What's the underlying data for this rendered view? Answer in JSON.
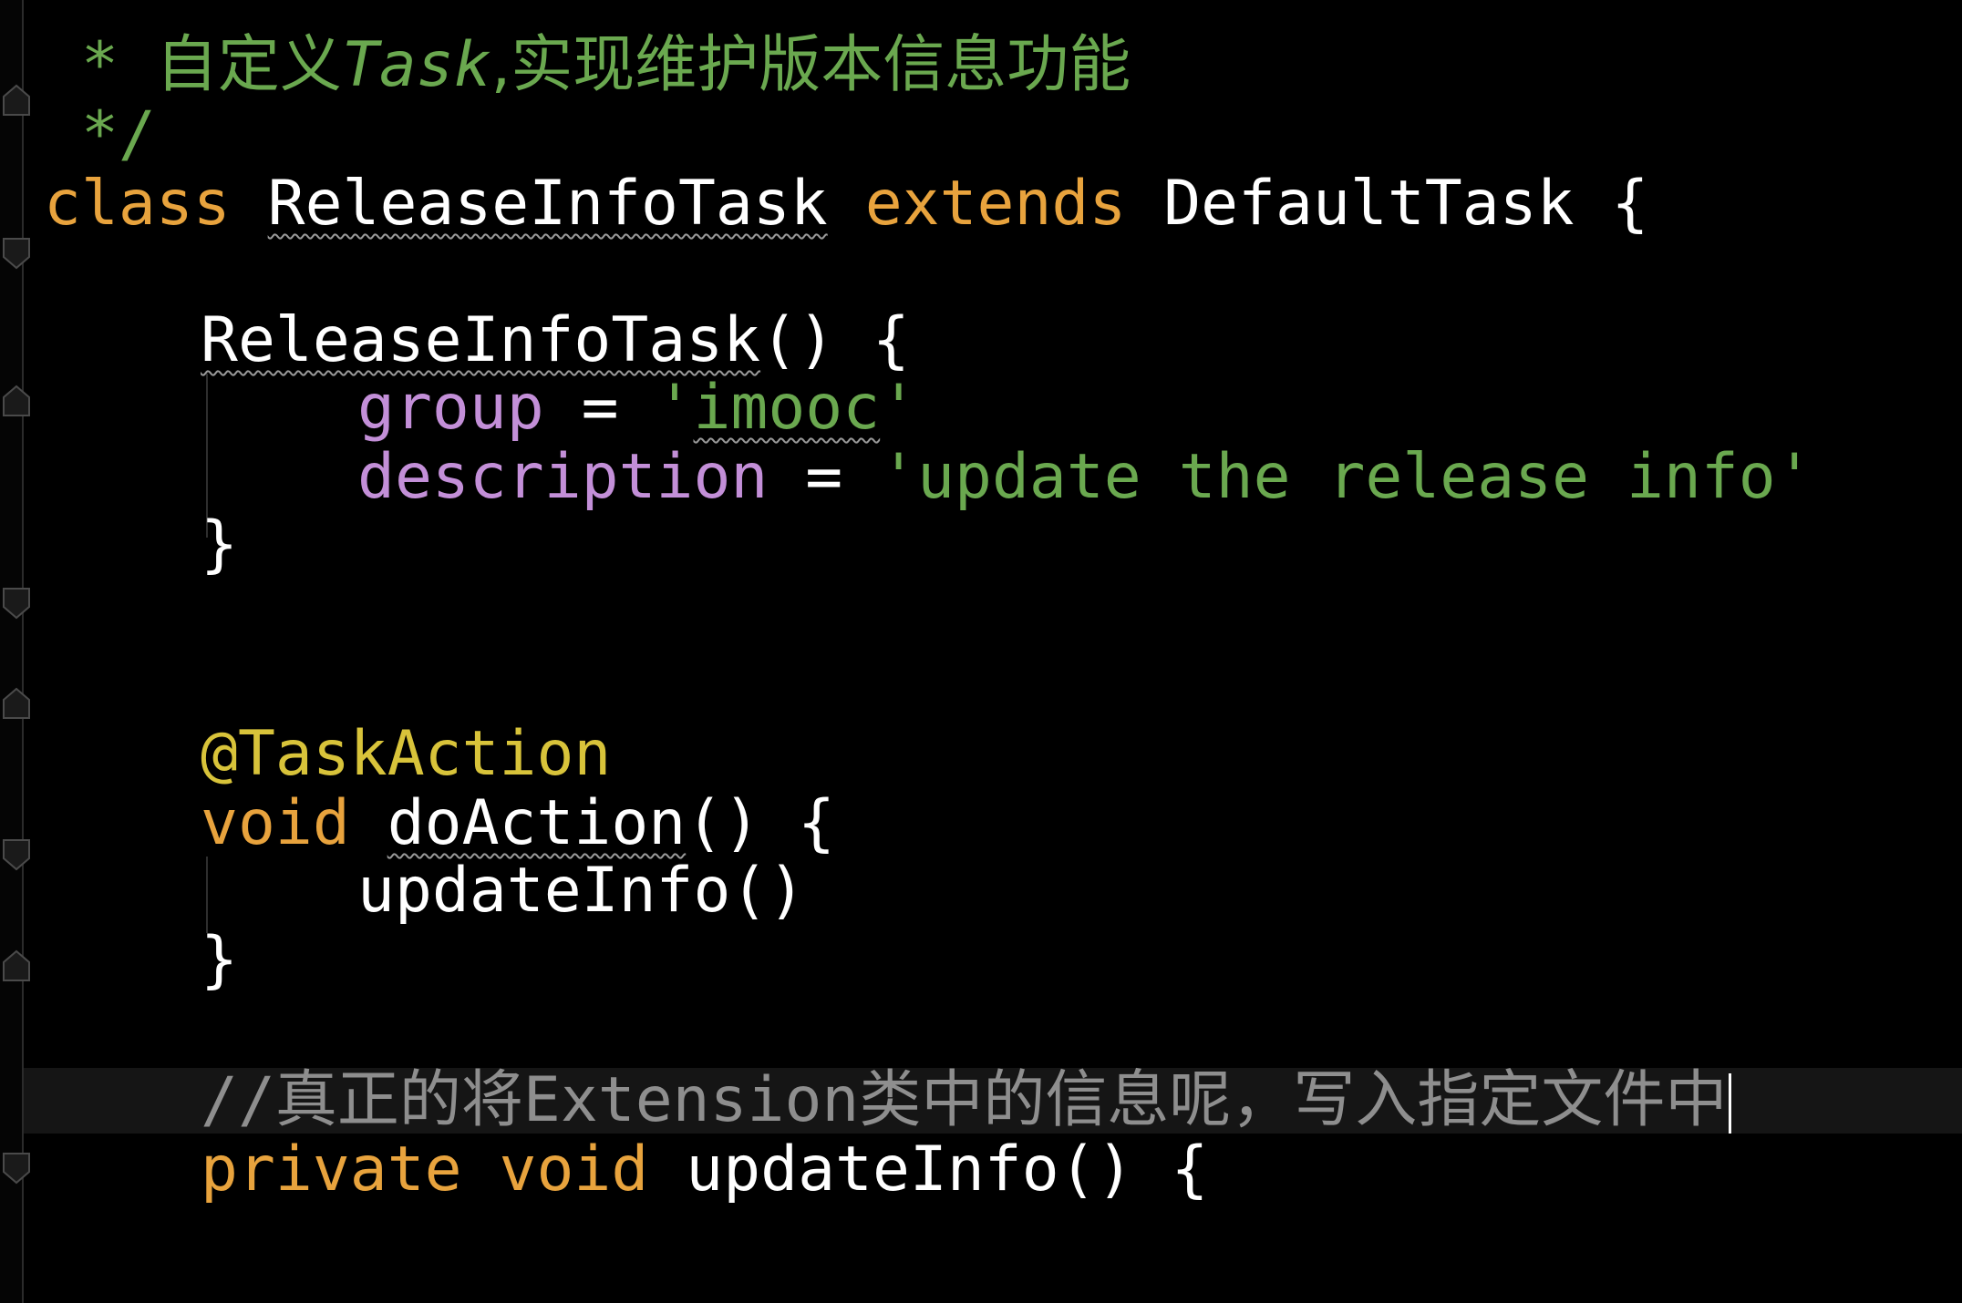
{
  "editor": {
    "lines": {
      "l1_prefix": " * ",
      "l1_text": "自定义",
      "l1_task": "Task",
      "l1_rest": ",实现维护版本信息功能",
      "l2": " */",
      "l3_kw": "class",
      "l3_name": "ReleaseInfoTask",
      "l3_ext": "extends",
      "l3_type": "DefaultTask",
      "l3_brace": "{",
      "l5_name": "ReleaseInfoTask",
      "l5_rest": "() {",
      "l6_field": "group",
      "l6_eq": " = ",
      "l6_q1": "'",
      "l6_str": "imooc",
      "l6_q2": "'",
      "l7_field": "description",
      "l7_eq": " = ",
      "l7_str": "'update the release info'",
      "l8": "}",
      "l11_annot": "@TaskAction",
      "l12_kw": "void",
      "l12_name": "doAction",
      "l12_rest": "() {",
      "l13": "updateInfo()",
      "l14": "}",
      "l16_slashes": "//",
      "l16_text1": "真正的将",
      "l16_ext": "Extension",
      "l16_text2": "类中的信息呢，写入指定文件中",
      "l17_kw1": "private",
      "l17_kw2": "void",
      "l17_name": "updateInfo",
      "l17_rest": "() {"
    }
  },
  "colors": {
    "background": "#000000",
    "comment": "#6aa84f",
    "keyword": "#e8a33d",
    "field": "#c38fd8",
    "string": "#6aa84f",
    "annotation": "#d8c33a",
    "line_comment": "#8e8e8e",
    "text": "#ffffff"
  }
}
